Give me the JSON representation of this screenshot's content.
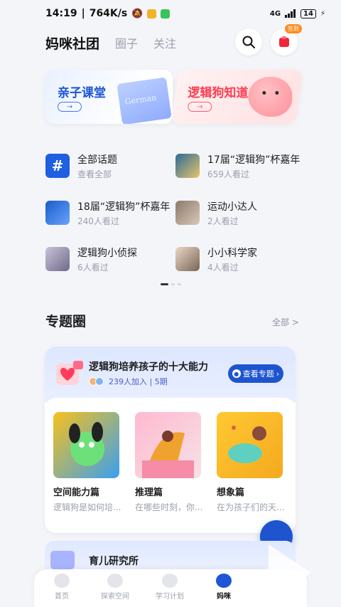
{
  "status_bar": {
    "time": "14:19",
    "speed": "764K/s",
    "signal": "4G",
    "battery": "14"
  },
  "header": {
    "tabs": [
      "妈咪社团",
      "圈子",
      "关注"
    ],
    "badge": "签到"
  },
  "banners": [
    {
      "title": "亲子课堂",
      "book_text": "German"
    },
    {
      "title": "逻辑狗知道"
    }
  ],
  "topics": [
    {
      "name": "全部话题",
      "sub": "查看全部"
    },
    {
      "name": "17届“逻辑狗”杯嘉年",
      "sub": "659人看过"
    },
    {
      "name": "18届“逻辑狗”杯嘉年",
      "sub": "240人看过"
    },
    {
      "name": "运动小达人",
      "sub": "2人看过"
    },
    {
      "name": "逻辑狗小侦探",
      "sub": "6人看过"
    },
    {
      "name": "小小科学家",
      "sub": "4人看过"
    }
  ],
  "section": {
    "title": "专题圈",
    "all": "全部 >"
  },
  "card": {
    "title": "逻辑狗培养孩子的十大能力",
    "meta": "239人加入 | 5期",
    "button": "查看专题",
    "items": [
      {
        "title": "空间能力篇",
        "desc": "逻辑狗是如何培..."
      },
      {
        "title": "推理篇",
        "desc": "在哪些时刻，你..."
      },
      {
        "title": "想象篇",
        "desc": "在为孩子们的天..."
      }
    ]
  },
  "card2": {
    "title": "育儿研究所"
  },
  "nav": [
    "首页",
    "探索空间",
    "学习计划",
    "妈咪"
  ]
}
